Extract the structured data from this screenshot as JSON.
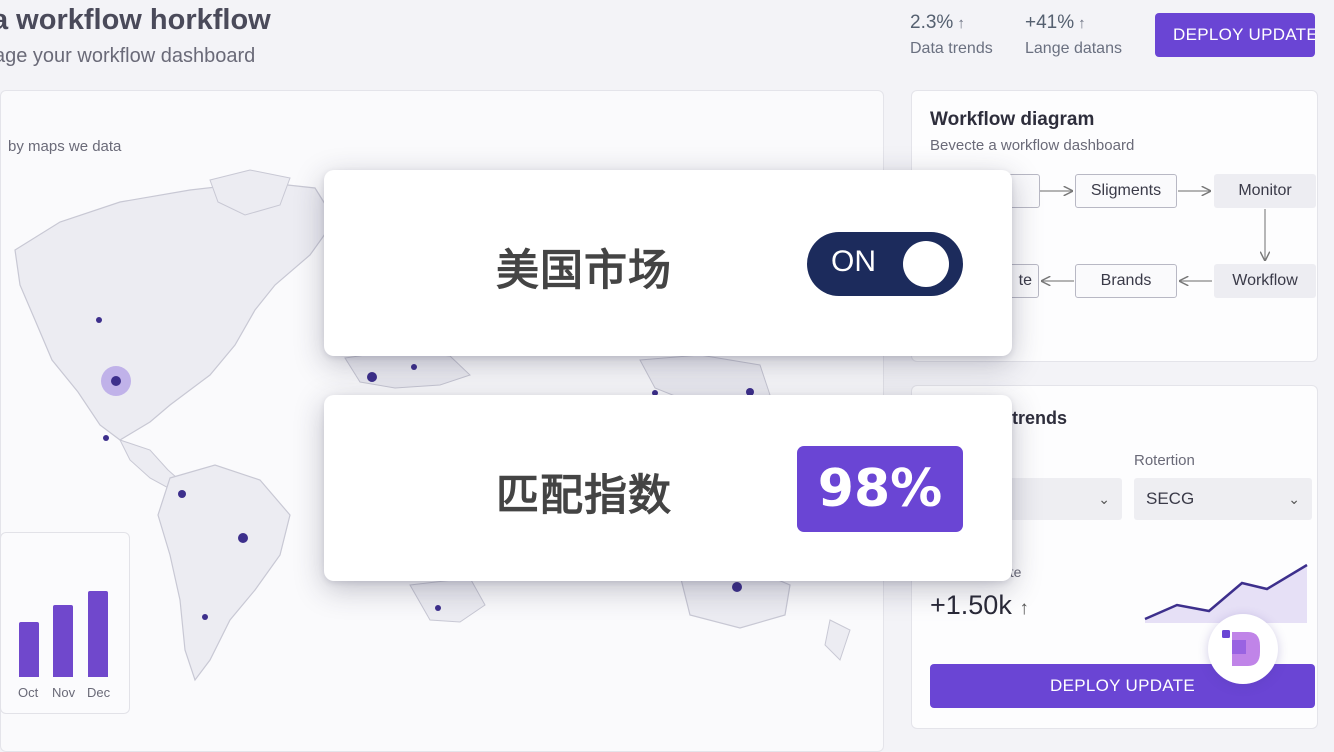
{
  "header": {
    "title": "a workflow horkflow",
    "subtitle": "age your workflow dashboard",
    "stats": [
      {
        "value": "2.3%",
        "label": "Data trends",
        "arrow": "↑"
      },
      {
        "value": "+41%",
        "label": "Lange datans",
        "arrow": "↑"
      }
    ],
    "deploy_label": "DEPLOY UPDATE"
  },
  "map": {
    "label": "by maps we data"
  },
  "bar_card": {
    "months": [
      "Oct",
      "Nov",
      "Dec"
    ],
    "chart_data": {
      "type": "bar",
      "categories": [
        "Oct",
        "Nov",
        "Dec"
      ],
      "values": [
        0.55,
        0.72,
        0.86
      ]
    }
  },
  "workflow": {
    "title": "Workflow diagram",
    "subtitle": "Bevecte a workflow dashboard",
    "nodes": {
      "sligments": "Sligments",
      "monitor": "Monitor",
      "brands": "Brands",
      "workflow": "Workflow",
      "partial": "te"
    }
  },
  "trends": {
    "title": "trends",
    "rotation_label": "Rotertion",
    "rotation_value": "SECG",
    "update_label": "ate",
    "update_value": "+1.50k",
    "update_arrow": "↑",
    "deploy_label": "DEPLOY UPDATE"
  },
  "overlay": {
    "market_label": "美国市场",
    "toggle_state": "ON",
    "match_label": "匹配指数",
    "match_value": "98%"
  },
  "colors": {
    "accent": "#6a45d4",
    "toggle": "#1c2b5c",
    "map_dot": "#3d2f8c"
  }
}
